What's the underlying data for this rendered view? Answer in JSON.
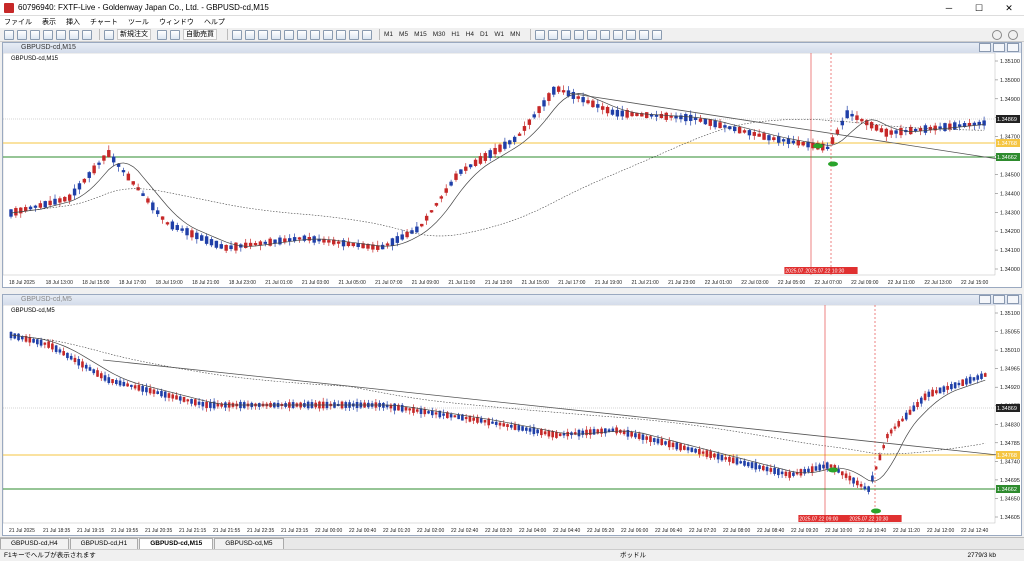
{
  "window": {
    "title": "60796940: FXTF-Live - Goldenway Japan Co., Ltd. - GBPUSD-cd,M15"
  },
  "menu": [
    "ファイル",
    "表示",
    "挿入",
    "チャート",
    "ツール",
    "ウィンドウ",
    "ヘルプ"
  ],
  "toolbar": {
    "new_order": "新規注文",
    "auto_trade": "自動売買",
    "timeframes": [
      "M1",
      "M5",
      "M15",
      "M30",
      "H1",
      "H4",
      "D1",
      "W1",
      "MN"
    ]
  },
  "chart1": {
    "window_title": "GBPUSD-cd,M15",
    "symbol_label": "GBPUSD-cd,M15",
    "price_labels": [
      "1.35100",
      "1.35000",
      "1.34900",
      "1.34800",
      "1.34700",
      "1.34600",
      "1.34500",
      "1.34400",
      "1.34300",
      "1.34200",
      "1.34100",
      "1.34000"
    ],
    "price_tags": {
      "current": "1.34869",
      "orange": "1.34768",
      "green": "1.34662"
    },
    "time_labels": [
      "18 Jul 2025",
      "18 Jul 13:00",
      "18 Jul 15:00",
      "18 Jul 17:00",
      "18 Jul 19:00",
      "18 Jul 21:00",
      "18 Jul 23:00",
      "21 Jul 01:00",
      "21 Jul 03:00",
      "21 Jul 05:00",
      "21 Jul 07:00",
      "21 Jul 09:00",
      "21 Jul 11:00",
      "21 Jul 13:00",
      "21 Jul 15:00",
      "21 Jul 17:00",
      "21 Jul 19:00",
      "21 Jul 21:00",
      "21 Jul 23:00",
      "22 Jul 01:00",
      "22 Jul 03:00",
      "22 Jul 05:00",
      "22 Jul 07:00",
      "22 Jul 09:00",
      "22 Jul 11:00",
      "22 Jul 13:00",
      "22 Jul 15:00"
    ],
    "vline_labels": [
      "2025.07.22 09:00",
      "2025.07.22 10:30"
    ]
  },
  "chart2": {
    "window_title": "GBPUSD-cd,M5",
    "symbol_label": "GBPUSD-cd,M5",
    "price_labels": [
      "1.35100",
      "1.35055",
      "1.35010",
      "1.34965",
      "1.34920",
      "1.34875",
      "1.34830",
      "1.34785",
      "1.34740",
      "1.34695",
      "1.34650",
      "1.34605"
    ],
    "price_tags": {
      "current": "1.34869",
      "green": "1.34662",
      "orange": "1.34768"
    },
    "time_labels": [
      "21 Jul 2025",
      "21 Jul 18:35",
      "21 Jul 19:15",
      "21 Jul 19:55",
      "21 Jul 20:35",
      "21 Jul 21:15",
      "21 Jul 21:55",
      "21 Jul 22:35",
      "21 Jul 23:15",
      "22 Jul 00:00",
      "22 Jul 00:40",
      "22 Jul 01:20",
      "22 Jul 02:00",
      "22 Jul 02:40",
      "22 Jul 03:20",
      "22 Jul 04:00",
      "22 Jul 04:40",
      "22 Jul 05:20",
      "22 Jul 06:00",
      "22 Jul 06:40",
      "22 Jul 07:20",
      "22 Jul 08:00",
      "22 Jul 08:40",
      "22 Jul 09:20",
      "22 Jul 10:00",
      "22 Jul 10:40",
      "22 Jul 11:20",
      "22 Jul 12:00",
      "22 Jul 12:40"
    ],
    "vline_labels": [
      "2025.07.22 09:00",
      "2025.07.22 10:30"
    ]
  },
  "tabs": [
    "GBPUSD-cd,H4",
    "GBPUSD-cd,H1",
    "GBPUSD-cd,M15",
    "GBPUSD-cd,M5"
  ],
  "active_tab": 2,
  "status": {
    "left": "F1キーでヘルプが表示されます",
    "mid": "ボッドル",
    "right": "2779/3 kb"
  },
  "colors": {
    "bull": "#1f3fa8",
    "bear": "#c62828",
    "hline_orange": "#f5c542",
    "hline_green": "#2e8b2e",
    "vline": "#e03030",
    "marker": "#2aa32a"
  }
}
